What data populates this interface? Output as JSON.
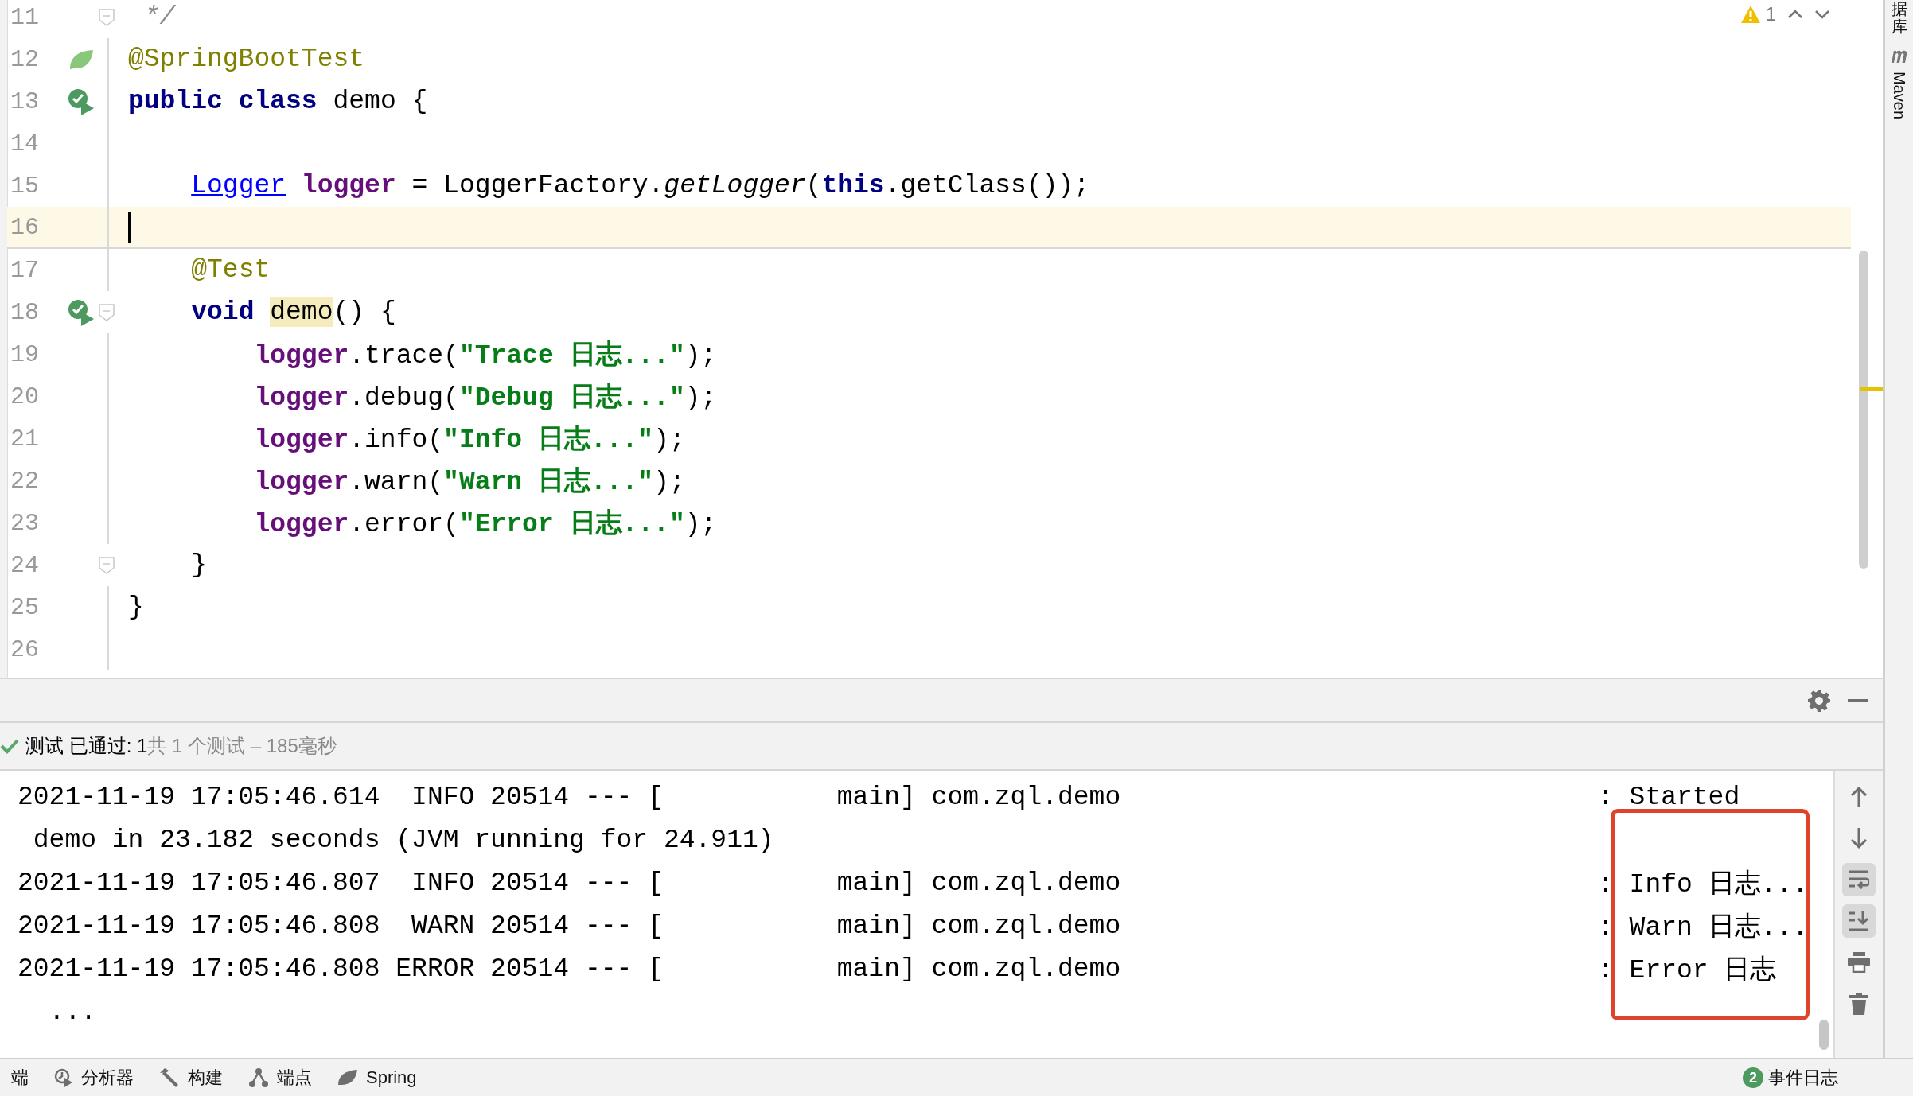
{
  "editor": {
    "warning_count": "1",
    "lines": [
      {
        "number": "11",
        "kind": "plain",
        "fold": true,
        "current": false,
        "tokens": [
          {
            "kind": "comment",
            "text": " */"
          }
        ]
      },
      {
        "number": "12",
        "kind": "spring",
        "fold": false,
        "current": false,
        "tokens": [
          {
            "kind": "annotation",
            "text": "@SpringBootTest"
          }
        ]
      },
      {
        "number": "13",
        "kind": "run",
        "fold": false,
        "current": false,
        "tokens": [
          {
            "kind": "keyword",
            "text": "public"
          },
          {
            "kind": "keyword",
            "text": " class"
          },
          {
            "kind": "plain",
            "text": " demo {"
          }
        ]
      },
      {
        "number": "14",
        "kind": "plain",
        "fold": false,
        "current": false
      },
      {
        "number": "15",
        "kind": "plain",
        "fold": false,
        "current": false,
        "tokens": [
          {
            "kind": "type",
            "text": "    Logger"
          },
          {
            "kind": "field",
            "text": " logger"
          },
          {
            "kind": "plain",
            "text": " = LoggerFactory."
          },
          {
            "kind": "method",
            "text": "getLogger"
          },
          {
            "kind": "plain",
            "text": "("
          },
          {
            "kind": "keyword",
            "text": "this"
          },
          {
            "kind": "plain",
            "text": ".getClass());"
          }
        ]
      },
      {
        "number": "16",
        "kind": "plain",
        "fold": false,
        "current": true
      },
      {
        "number": "17",
        "kind": "plain",
        "fold": false,
        "current": false,
        "tokens": [
          {
            "kind": "annotation",
            "text": "    @Test"
          }
        ]
      },
      {
        "number": "18",
        "kind": "run",
        "fold": true,
        "current": false,
        "tokens": [
          {
            "kind": "keyword",
            "text": "    void"
          },
          {
            "kind": "usage",
            "text": " demo"
          },
          {
            "kind": "plain",
            "text": "() {"
          }
        ]
      },
      {
        "number": "19",
        "kind": "plain",
        "fold": false,
        "current": false,
        "tokens": [
          {
            "kind": "field",
            "text": "        logger"
          },
          {
            "kind": "plain",
            "text": ".trace("
          },
          {
            "kind": "string",
            "text": "\"Trace 日志...\""
          },
          {
            "kind": "plain",
            "text": ");"
          }
        ]
      },
      {
        "number": "20",
        "kind": "plain",
        "fold": false,
        "current": false,
        "tokens": [
          {
            "kind": "field",
            "text": "        logger"
          },
          {
            "kind": "plain",
            "text": ".debug("
          },
          {
            "kind": "string",
            "text": "\"Debug 日志...\""
          },
          {
            "kind": "plain",
            "text": ");"
          }
        ]
      },
      {
        "number": "21",
        "kind": "plain",
        "fold": false,
        "current": false,
        "tokens": [
          {
            "kind": "field",
            "text": "        logger"
          },
          {
            "kind": "plain",
            "text": ".info("
          },
          {
            "kind": "string",
            "text": "\"Info 日志...\""
          },
          {
            "kind": "plain",
            "text": ");"
          }
        ]
      },
      {
        "number": "22",
        "kind": "plain",
        "fold": false,
        "current": false,
        "tokens": [
          {
            "kind": "field",
            "text": "        logger"
          },
          {
            "kind": "plain",
            "text": ".warn("
          },
          {
            "kind": "string",
            "text": "\"Warn 日志...\""
          },
          {
            "kind": "plain",
            "text": ");"
          }
        ]
      },
      {
        "number": "23",
        "kind": "plain",
        "fold": false,
        "current": false,
        "tokens": [
          {
            "kind": "field",
            "text": "        logger"
          },
          {
            "kind": "plain",
            "text": ".error("
          },
          {
            "kind": "string",
            "text": "\"Error 日志...\""
          },
          {
            "kind": "plain",
            "text": ");"
          }
        ]
      },
      {
        "number": "24",
        "kind": "plain",
        "fold": true,
        "current": false,
        "tokens": [
          {
            "kind": "plain",
            "text": "    }"
          }
        ]
      },
      {
        "number": "25",
        "kind": "plain",
        "fold": false,
        "current": false,
        "tokens": [
          {
            "kind": "plain",
            "text": "}"
          }
        ]
      },
      {
        "number": "26",
        "kind": "plain",
        "fold": false,
        "current": false
      }
    ]
  },
  "run_panel": {
    "status": {
      "passed": "测试 已通过: 1",
      "summary": "共 1 个测试 – 185毫秒"
    },
    "console": {
      "highlight_frame": true,
      "lines": [
        {
          "text": "2021-11-19 17:05:46.614  INFO 20514 --- [           main] com.zql.demo",
          "message": ": Started"
        },
        {
          "text": " demo in 23.182 seconds (JVM running for 24.911)"
        },
        {
          "text": "2021-11-19 17:05:46.807  INFO 20514 --- [           main] com.zql.demo",
          "message": ": Info 日志..."
        },
        {
          "text": "2021-11-19 17:05:46.808  WARN 20514 --- [           main] com.zql.demo",
          "message": ": Warn 日志..."
        },
        {
          "text": "2021-11-19 17:05:46.808 ERROR 20514 --- [           main] com.zql.demo",
          "message": ": Error 日志"
        },
        {
          "text": "  ..."
        }
      ]
    },
    "tools": [
      {
        "kind": "up",
        "selected": false
      },
      {
        "kind": "down",
        "selected": false
      },
      {
        "kind": "wrap",
        "selected": true
      },
      {
        "kind": "scroll-end",
        "selected": true
      },
      {
        "kind": "print",
        "selected": false
      },
      {
        "kind": "trash",
        "selected": false
      }
    ]
  },
  "side_strip": [
    {
      "kind": "text",
      "label": "据库"
    },
    {
      "kind": "maven",
      "label": "Maven"
    }
  ],
  "bottom_bar": {
    "tabs": [
      {
        "kind": "none",
        "label": "端"
      },
      {
        "kind": "profiler",
        "label": "分析器"
      },
      {
        "kind": "build",
        "label": "构建"
      },
      {
        "kind": "endpoints",
        "label": "端点"
      },
      {
        "kind": "spring",
        "label": "Spring"
      }
    ],
    "event_log": {
      "badge": "2",
      "label": "事件日志"
    }
  }
}
